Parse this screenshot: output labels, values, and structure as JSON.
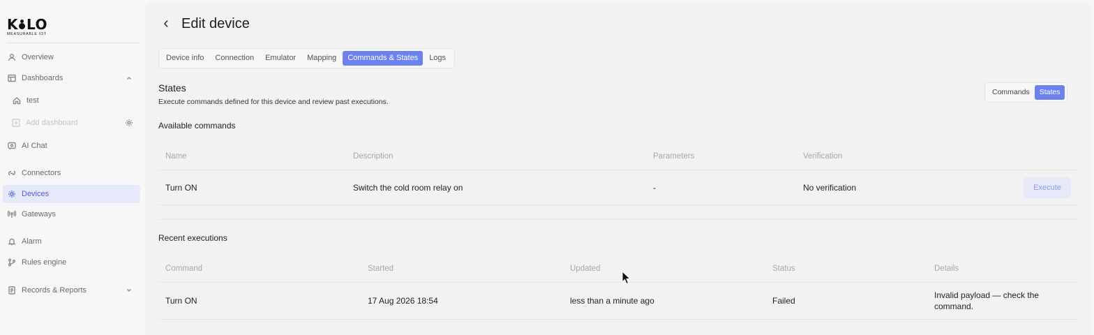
{
  "brand": {
    "name_left": "K",
    "name_right": "LO",
    "tagline": "MEASURABLE IOT"
  },
  "sidebar": {
    "items": [
      {
        "label": "Overview",
        "icon": "user-icon"
      },
      {
        "label": "Dashboards",
        "icon": "dashboard-icon",
        "expanded": true
      },
      {
        "label": "test",
        "icon": "home-icon"
      },
      {
        "label": "Add dashboard",
        "icon": "plus-square-icon",
        "disabled": true
      },
      {
        "label": "AI Chat",
        "icon": "chat-icon"
      },
      {
        "label": "Connectors",
        "icon": "connectors-icon"
      },
      {
        "label": "Devices",
        "icon": "gear-icon",
        "active": true
      },
      {
        "label": "Gateways",
        "icon": "antenna-icon"
      },
      {
        "label": "Alarm",
        "icon": "bell-icon"
      },
      {
        "label": "Rules engine",
        "icon": "branch-icon"
      },
      {
        "label": "Records & Reports",
        "icon": "report-icon",
        "expanded": false
      }
    ]
  },
  "header": {
    "title": "Edit device"
  },
  "tabs": [
    {
      "label": "Device info"
    },
    {
      "label": "Connection"
    },
    {
      "label": "Emulator"
    },
    {
      "label": "Mapping"
    },
    {
      "label": "Commands & States",
      "active": true
    },
    {
      "label": "Logs"
    }
  ],
  "section": {
    "title": "States",
    "description": "Execute commands defined for this device and review past executions."
  },
  "toggle": {
    "commands": "Commands",
    "states": "States",
    "selected": "States"
  },
  "available": {
    "title": "Available commands",
    "columns": [
      "Name",
      "Description",
      "Parameters",
      "Verification"
    ],
    "rows": [
      {
        "name": "Turn ON",
        "description": "Switch the cold room relay on",
        "parameters": "-",
        "verification": "No verification",
        "action": "Execute"
      }
    ]
  },
  "recent": {
    "title": "Recent executions",
    "columns": [
      "Command",
      "Started",
      "Updated",
      "Status",
      "Details"
    ],
    "rows": [
      {
        "command": "Turn ON",
        "started": "17 Aug 2026 18:54",
        "updated": "less than a minute ago",
        "status": "Failed",
        "details": "Invalid payload — check the command."
      }
    ]
  },
  "colors": {
    "accent": "#6b82ec",
    "active_nav_bg": "#e6e9f9",
    "active_nav_text": "#4c5bd4"
  }
}
